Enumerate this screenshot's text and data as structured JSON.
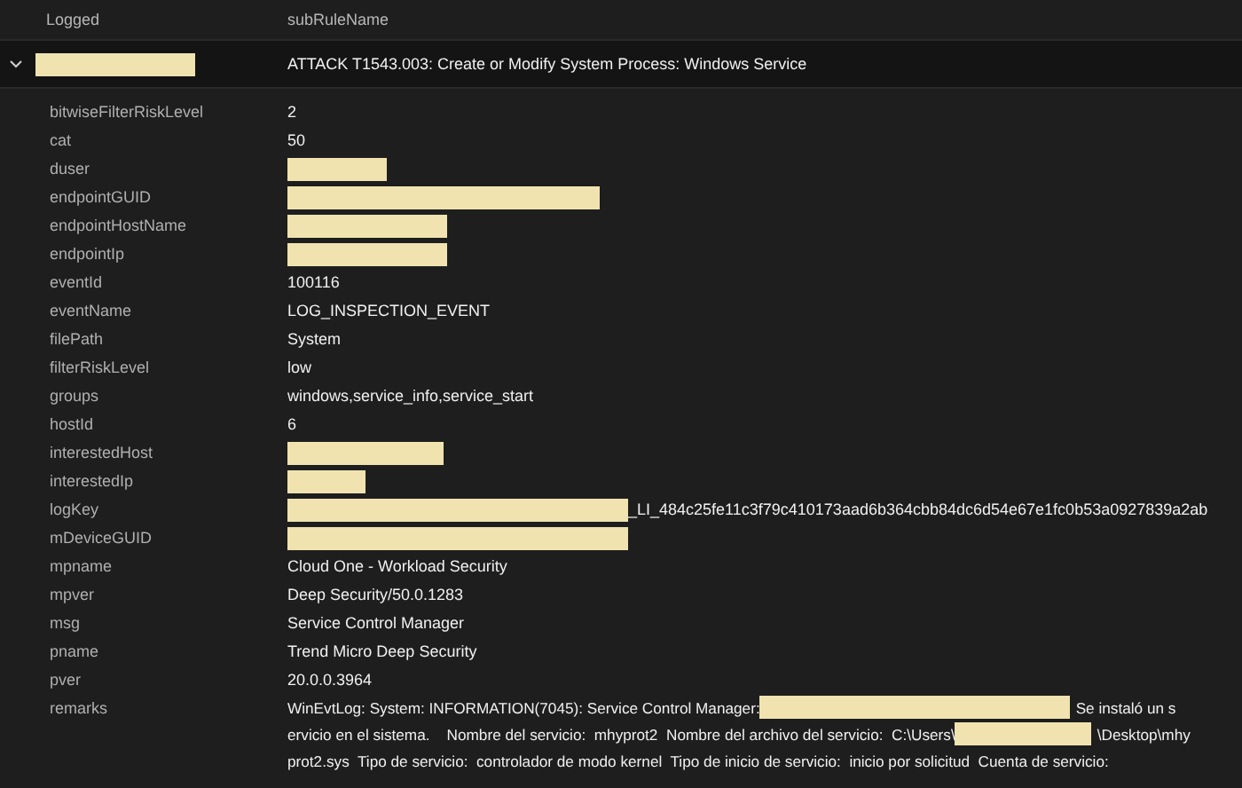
{
  "columns": [
    "Logged",
    "subRuleName"
  ],
  "event": {
    "expanded": true,
    "logged": [
      {
        "kind": "redacted"
      }
    ],
    "subRuleName": "ATTACK T1543.003: Create or Modify System Process: Windows Service"
  },
  "fields": [
    {
      "key": "bitwiseFilterRiskLevel",
      "lines": [
        [
          {
            "kind": "text",
            "text": "2"
          }
        ]
      ]
    },
    {
      "key": "cat",
      "lines": [
        [
          {
            "kind": "text",
            "text": "50"
          }
        ]
      ]
    },
    {
      "key": "duser",
      "lines": [
        [
          {
            "kind": "redacted"
          }
        ]
      ]
    },
    {
      "key": "endpointGUID",
      "lines": [
        [
          {
            "kind": "redacted"
          }
        ]
      ]
    },
    {
      "key": "endpointHostName",
      "lines": [
        [
          {
            "kind": "redacted"
          }
        ]
      ]
    },
    {
      "key": "endpointIp",
      "lines": [
        [
          {
            "kind": "redacted"
          }
        ]
      ]
    },
    {
      "key": "eventId",
      "lines": [
        [
          {
            "kind": "text",
            "text": "100116"
          }
        ]
      ]
    },
    {
      "key": "eventName",
      "lines": [
        [
          {
            "kind": "text",
            "text": "LOG_INSPECTION_EVENT"
          }
        ]
      ]
    },
    {
      "key": "filePath",
      "lines": [
        [
          {
            "kind": "text",
            "text": "System"
          }
        ]
      ]
    },
    {
      "key": "filterRiskLevel",
      "lines": [
        [
          {
            "kind": "text",
            "text": "low"
          }
        ]
      ]
    },
    {
      "key": "groups",
      "lines": [
        [
          {
            "kind": "text",
            "text": "windows,service_info,service_start"
          }
        ]
      ]
    },
    {
      "key": "hostId",
      "lines": [
        [
          {
            "kind": "text",
            "text": "6"
          }
        ]
      ]
    },
    {
      "key": "interestedHost",
      "lines": [
        [
          {
            "kind": "redacted"
          }
        ]
      ]
    },
    {
      "key": "interestedIp",
      "lines": [
        [
          {
            "kind": "redacted"
          }
        ]
      ]
    },
    {
      "key": "logKey",
      "lines": [
        [
          {
            "kind": "redacted"
          },
          {
            "kind": "text",
            "text": "_LI_484c25fe11c3f79c410173aad6b364cbb84dc6d54e67e1fc0b53a0927839a2ab"
          }
        ]
      ]
    },
    {
      "key": "mDeviceGUID",
      "lines": [
        [
          {
            "kind": "redacted"
          }
        ]
      ]
    },
    {
      "key": "mpname",
      "lines": [
        [
          {
            "kind": "text",
            "text": "Cloud One - Workload Security"
          }
        ]
      ]
    },
    {
      "key": "mpver",
      "lines": [
        [
          {
            "kind": "text",
            "text": "Deep Security/50.0.1283"
          }
        ]
      ]
    },
    {
      "key": "msg",
      "lines": [
        [
          {
            "kind": "text",
            "text": "Service Control Manager"
          }
        ]
      ]
    },
    {
      "key": "pname",
      "lines": [
        [
          {
            "kind": "text",
            "text": "Trend Micro Deep Security"
          }
        ]
      ]
    },
    {
      "key": "pver",
      "lines": [
        [
          {
            "kind": "text",
            "text": "20.0.0.3964"
          }
        ]
      ]
    },
    {
      "key": "remarks",
      "lines": [
        [
          {
            "kind": "text",
            "text": "WinEvtLog: System: INFORMATION(7045): Service Control Manager:"
          },
          {
            "kind": "redacted"
          },
          {
            "kind": "text",
            "text": "Se instaló un s"
          }
        ],
        [
          {
            "kind": "text",
            "text": "ervicio en el sistema.    Nombre del servicio:  mhyprot2  Nombre del archivo del servicio:  C:\\Users\\"
          },
          {
            "kind": "redacted"
          },
          {
            "kind": "text",
            "text": "\\Desktop\\mhy"
          }
        ],
        [
          {
            "kind": "text",
            "text": "prot2.sys  Tipo de servicio:  controlador de modo kernel  Tipo de inicio de servicio:  inicio por solicitud  Cuenta de servicio:"
          }
        ]
      ]
    }
  ]
}
